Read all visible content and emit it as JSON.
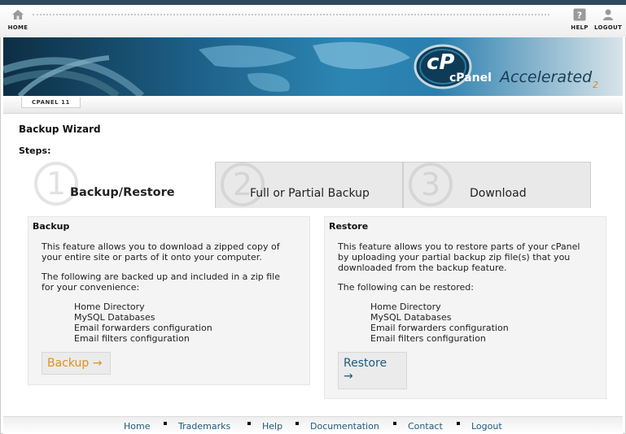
{
  "topnav": {
    "home_label": "HOME",
    "help_label": "HELP",
    "logout_label": "LOGOUT"
  },
  "banner": {
    "logo_letter": "cP",
    "brand_cpanel": "cPanel",
    "brand_accelerated": "Accelerated",
    "brand_version": "2"
  },
  "tabstrip": {
    "version_label": "CPANEL 11"
  },
  "page": {
    "title": "Backup Wizard",
    "steps_label": "Steps:"
  },
  "steps": [
    {
      "number": "1",
      "label": "Backup/Restore",
      "active": true
    },
    {
      "number": "2",
      "label": "Full or Partial Backup",
      "active": false
    },
    {
      "number": "3",
      "label": "Download",
      "active": false
    }
  ],
  "backup": {
    "heading": "Backup",
    "desc_line1": "This feature allows you to download a zipped copy of",
    "desc_line2": "your entire site or parts of it onto your computer.",
    "list_intro_line1": "The following are backed up and included in a zip file",
    "list_intro_line2": "for your convenience:",
    "items": [
      "Home Directory",
      "MySQL Databases",
      "Email forwarders configuration",
      "Email filters configuration"
    ],
    "button_label": "Backup →"
  },
  "restore": {
    "heading": "Restore",
    "desc_line1": "This feature allows you to restore parts of your cPanel",
    "desc_line2": "by uploading your partial backup zip file(s) that you",
    "desc_line3": "downloaded from the backup feature.",
    "list_intro": "The following can be restored:",
    "items": [
      "Home Directory",
      "MySQL Databases",
      "Email forwarders configuration",
      "Email filters configuration"
    ],
    "button_line1": "Restore",
    "button_line2": "→"
  },
  "footer": {
    "links": [
      "Home",
      "Trademarks",
      "Help",
      "Documentation",
      "Contact",
      "Logout"
    ]
  },
  "colors": {
    "link": "#1d5a7d",
    "backup_button_text": "#e0901e",
    "panel_bg": "#f4f4f4"
  }
}
